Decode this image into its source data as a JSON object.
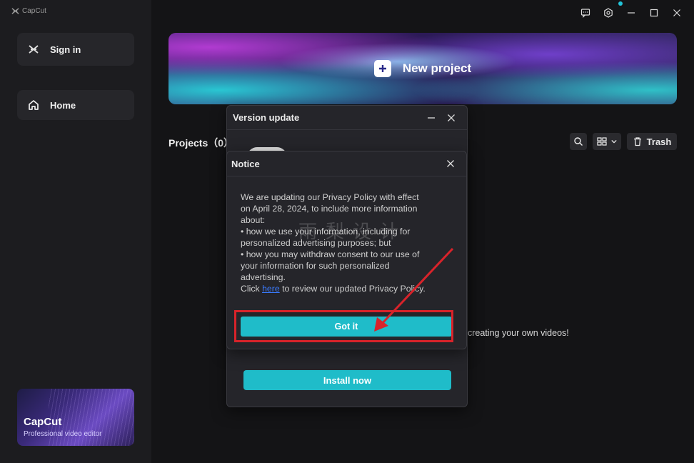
{
  "app": {
    "title": "CapCut"
  },
  "sidebar": {
    "sign_in": "Sign in",
    "home": "Home",
    "promo": {
      "title": "CapCut",
      "subtitle": "Professional video editor"
    }
  },
  "window_controls": [
    "feedback-icon",
    "settings-icon",
    "minimize-icon",
    "maximize-icon",
    "close-icon"
  ],
  "banner": {
    "label": "New project"
  },
  "projects": {
    "title": "Projects（0）",
    "trash_label": "Trash"
  },
  "background_tip": "creating your own videos!",
  "version_dialog": {
    "title": "Version update",
    "install_label": "Install now"
  },
  "notice_dialog": {
    "title": "Notice",
    "lines": [
      "We are updating our Privacy Policy with effect",
      "on April 28, 2024, to include more information",
      "about:",
      "• how we use your information, including for",
      "personalized advertising purposes; but",
      "• how you may withdraw consent to our use of",
      "your information for such personalized",
      "advertising."
    ],
    "click_prefix": "Click ",
    "click_link": "here",
    "click_suffix": " to review our updated Privacy Policy.",
    "got_it_label": "Got it"
  },
  "watermark": "雨梨设计",
  "colors": {
    "accent": "#1fbcc9",
    "highlight": "#d8232a",
    "link": "#3a7bff"
  }
}
